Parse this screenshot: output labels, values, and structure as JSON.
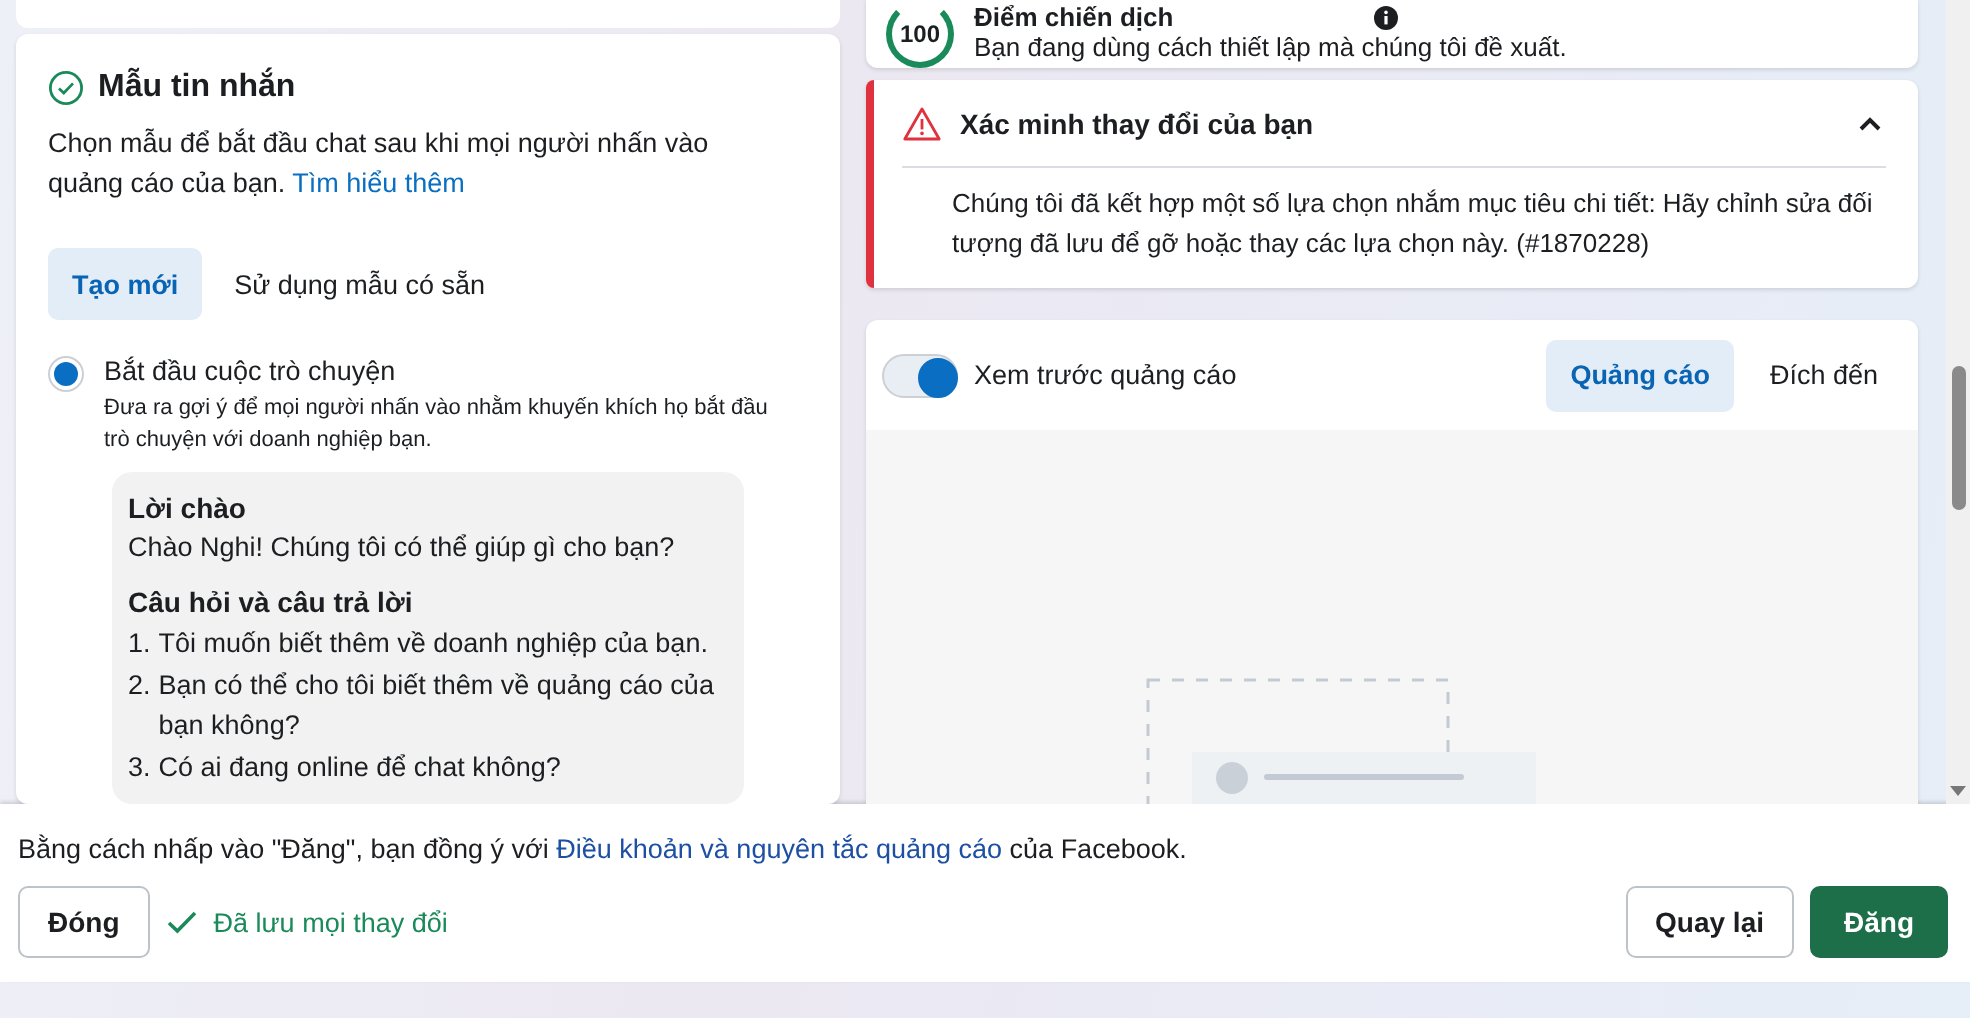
{
  "message_template": {
    "title": "Mẫu tin nhắn",
    "description": "Chọn mẫu để bắt đầu chat sau khi mọi người nhấn vào quảng cáo của bạn.",
    "learn_more_link": "Tìm hiểu thêm",
    "tabs": [
      {
        "label": "Tạo mới",
        "selected": true
      },
      {
        "label": "Sử dụng mẫu có sẵn",
        "selected": false
      }
    ],
    "options": [
      {
        "label": "Bắt đầu cuộc trò chuyện",
        "description": "Đưa ra gợi ý để mọi người nhấn vào nhằm khuyến khích họ bắt đầu trò chuyện với doanh nghiệp bạn.",
        "selected": true
      }
    ],
    "preview": {
      "greeting_heading": "Lời chào",
      "greeting": "Chào Nghi! Chúng tôi có thể giúp gì cho bạn?",
      "faq_heading": "Câu hỏi và câu trả lời",
      "questions": [
        {
          "number": "1.",
          "text": "Tôi muốn biết thêm về doanh nghiệp của bạn."
        },
        {
          "number": "2.",
          "text": "Bạn có thể cho tôi biết thêm về quảng cáo của bạn không?"
        },
        {
          "number": "3.",
          "text": "Có ai đang online để chat không?"
        }
      ]
    }
  },
  "campaign_score": {
    "score": "100",
    "title": "Điểm chiến dịch",
    "subtitle": "Bạn đang dùng cách thiết lập mà chúng tôi đề xuất."
  },
  "alert": {
    "title": "Xác minh thay đổi của bạn",
    "expanded": true,
    "message": "Chúng tôi đã kết hợp một số lựa chọn nhắm mục tiêu chi tiết: Hãy chỉnh sửa đối tượng đã lưu để gỡ hoặc thay các lựa chọn này. (#1870228)"
  },
  "ad_preview": {
    "toggle_label": "Xem trước quảng cáo",
    "toggle_on": true,
    "tabs": [
      {
        "label": "Quảng cáo",
        "selected": true
      },
      {
        "label": "Đích đến",
        "selected": false
      }
    ]
  },
  "footer": {
    "terms_before": "Bằng cách nhấp vào \"Đăng\", bạn đồng ý với",
    "terms_link": "Điều khoản và nguyên tắc quảng cáo",
    "terms_after": "của Facebook.",
    "close_button": "Đóng",
    "saved_status": "Đã lưu mọi thay đổi",
    "back_button": "Quay lại",
    "publish_button": "Đăng"
  }
}
